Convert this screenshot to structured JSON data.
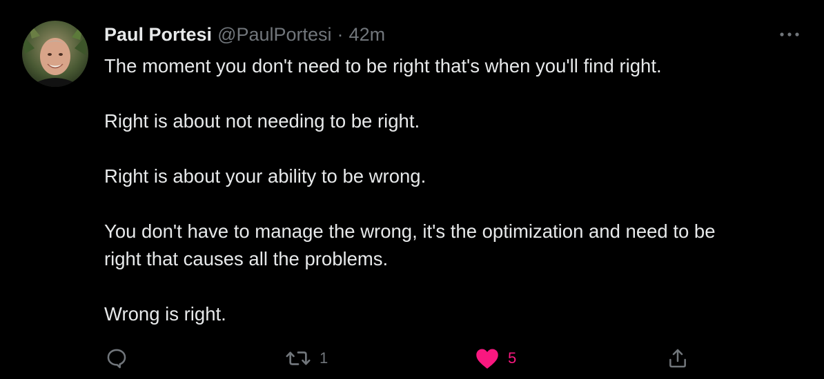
{
  "tweet": {
    "display_name": "Paul Portesi",
    "handle": "@PaulPortesi",
    "separator": "·",
    "time": "42m",
    "paragraphs": [
      "The moment you don't need to be right that's when you'll find right.",
      "Right is about not needing to be right.",
      "Right is about your ability to be wrong.",
      "You don't have to manage the wrong, it's the optimization and need to be\nright that causes all the problems.",
      "Wrong is right."
    ]
  },
  "actions": {
    "reply_icon": "reply-icon",
    "retweet_icon": "retweet-icon",
    "retweet_count": "1",
    "like_icon": "heart-icon",
    "like_count": "5",
    "share_icon": "share-icon",
    "more_icon": "more-icon"
  },
  "colors": {
    "background": "#000000",
    "text_primary": "#e7e9ea",
    "text_secondary": "#71767b",
    "like_active": "#f91880"
  }
}
